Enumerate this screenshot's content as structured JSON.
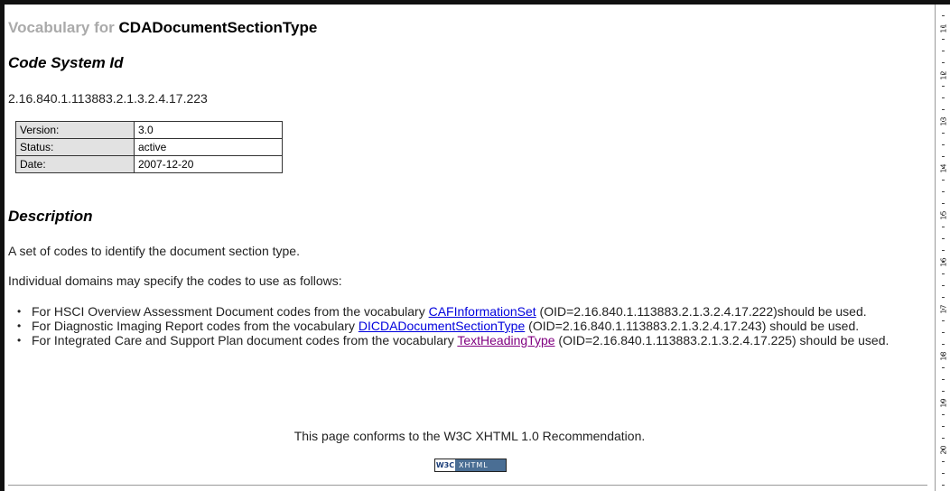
{
  "header": {
    "prefix": "Vocabulary for",
    "name": "CDADocumentSectionType"
  },
  "code_system": {
    "heading": "Code System Id",
    "oid": "2.16.840.1.113883.2.1.3.2.4.17.223"
  },
  "meta_table": [
    {
      "key": "Version:",
      "value": "3.0"
    },
    {
      "key": "Status:",
      "value": "active"
    },
    {
      "key": "Date:",
      "value": "2007-12-20"
    }
  ],
  "description": {
    "heading": "Description",
    "text": "A set of codes to identify the document section type.",
    "intro": "Individual domains may specify the codes to use as follows:",
    "items": [
      {
        "before": "For HSCI Overview Assessment Document codes from the vocabulary ",
        "link": "CAFInformationSet",
        "after": " (OID=2.16.840.1.113883.2.1.3.2.4.17.222)should be used."
      },
      {
        "before": "For Diagnostic Imaging Report codes from the vocabulary ",
        "link": "DICDADocumentSectionType",
        "after": " (OID=2.16.840.1.113883.2.1.3.2.4.17.243) should be used."
      },
      {
        "before": "For Integrated Care and Support Plan document codes from the vocabulary ",
        "link": "TextHeadingType",
        "after": " (OID=2.16.840.1.113883.2.1.3.2.4.17.225) should be used."
      }
    ]
  },
  "footer": {
    "conformance": "This page conforms to the W3C XHTML 1.0 Recommendation.",
    "badge_w3c": "W3C",
    "badge_xhtml": "XHTML"
  },
  "ruler": {
    "labels": [
      "11",
      "12",
      "13",
      "14",
      "15",
      "16",
      "17",
      "18",
      "19",
      "20"
    ]
  },
  "colors": {
    "link": "#0000dd",
    "visited_link": "#800080",
    "table_key_bg": "#e2e2e2",
    "title_prefix": "#aaaaaa"
  }
}
